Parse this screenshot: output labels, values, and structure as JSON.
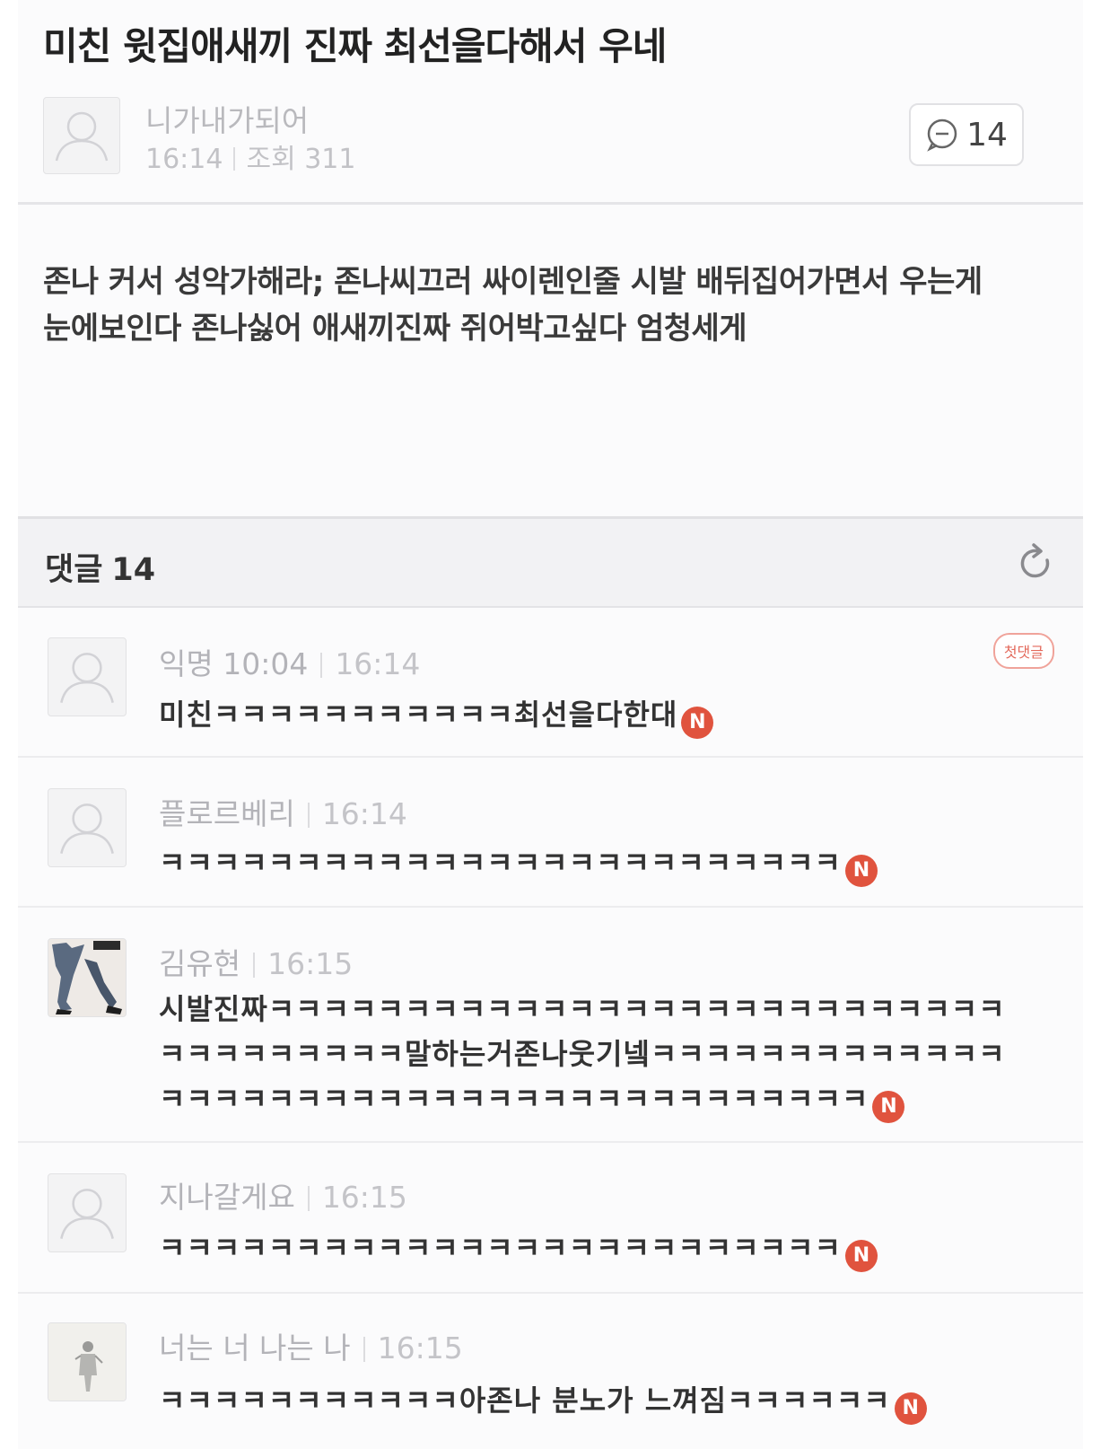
{
  "post": {
    "title": "미친 윗집애새끼 진짜 최선을다해서 우네",
    "author": "니가내가되어",
    "time": "16:14",
    "views_label": "조회 311",
    "comment_count": "14",
    "body": "존나 커서 성악가해라; 존나씨끄러 싸이렌인줄 시발 배뒤집어가면서 우는게 눈에보인다 존나싫어 애새끼진짜 쥐어박고싶다 엄청세게"
  },
  "comments_header": {
    "label": "댓글",
    "count": "14"
  },
  "comments": [
    {
      "name": "익명 10:04",
      "time": "16:14",
      "text": "미친ㅋㅋㅋㅋㅋㅋㅋㅋㅋㅋㅋ최선을다한대",
      "badge": "N",
      "first_badge": "첫댓글",
      "avatar": "default-user-icon"
    },
    {
      "name": "플로르베리",
      "time": "16:14",
      "text": "ㅋㅋㅋㅋㅋㅋㅋㅋㅋㅋㅋㅋㅋㅋㅋㅋㅋㅋㅋㅋㅋㅋㅋㅋㅋ",
      "badge": "N",
      "avatar": "default-user-icon"
    },
    {
      "name": "김유현",
      "time": "16:15",
      "text": "시발진짜ㅋㅋㅋㅋㅋㅋㅋㅋㅋㅋㅋㅋㅋㅋㅋㅋㅋㅋㅋㅋㅋㅋㅋㅋㅋㅋㅋㅋㅋㅋㅋㅋㅋㅋㅋㅋ말하는거존나웃기넼ㅋㅋㅋㅋㅋㅋㅋㅋㅋㅋㅋㅋㅋㅋㅋㅋㅋㅋㅋㅋㅋㅋㅋㅋㅋㅋㅋㅋㅋㅋㅋㅋㅋㅋㅋㅋㅋㅋㅋ",
      "badge": "N",
      "avatar": "photo-avatar"
    },
    {
      "name": "지나갈게요",
      "time": "16:15",
      "text": "ㅋㅋㅋㅋㅋㅋㅋㅋㅋㅋㅋㅋㅋㅋㅋㅋㅋㅋㅋㅋㅋㅋㅋㅋㅋ",
      "badge": "N",
      "avatar": "default-user-icon"
    },
    {
      "name": "너는 너 나는 나",
      "time": "16:15",
      "text": "ㅋㅋㅋㅋㅋㅋㅋㅋㅋㅋㅋ아존나 분노가 느껴짐ㅋㅋㅋㅋㅋㅋ",
      "badge": "N",
      "avatar": "photo-avatar"
    }
  ]
}
